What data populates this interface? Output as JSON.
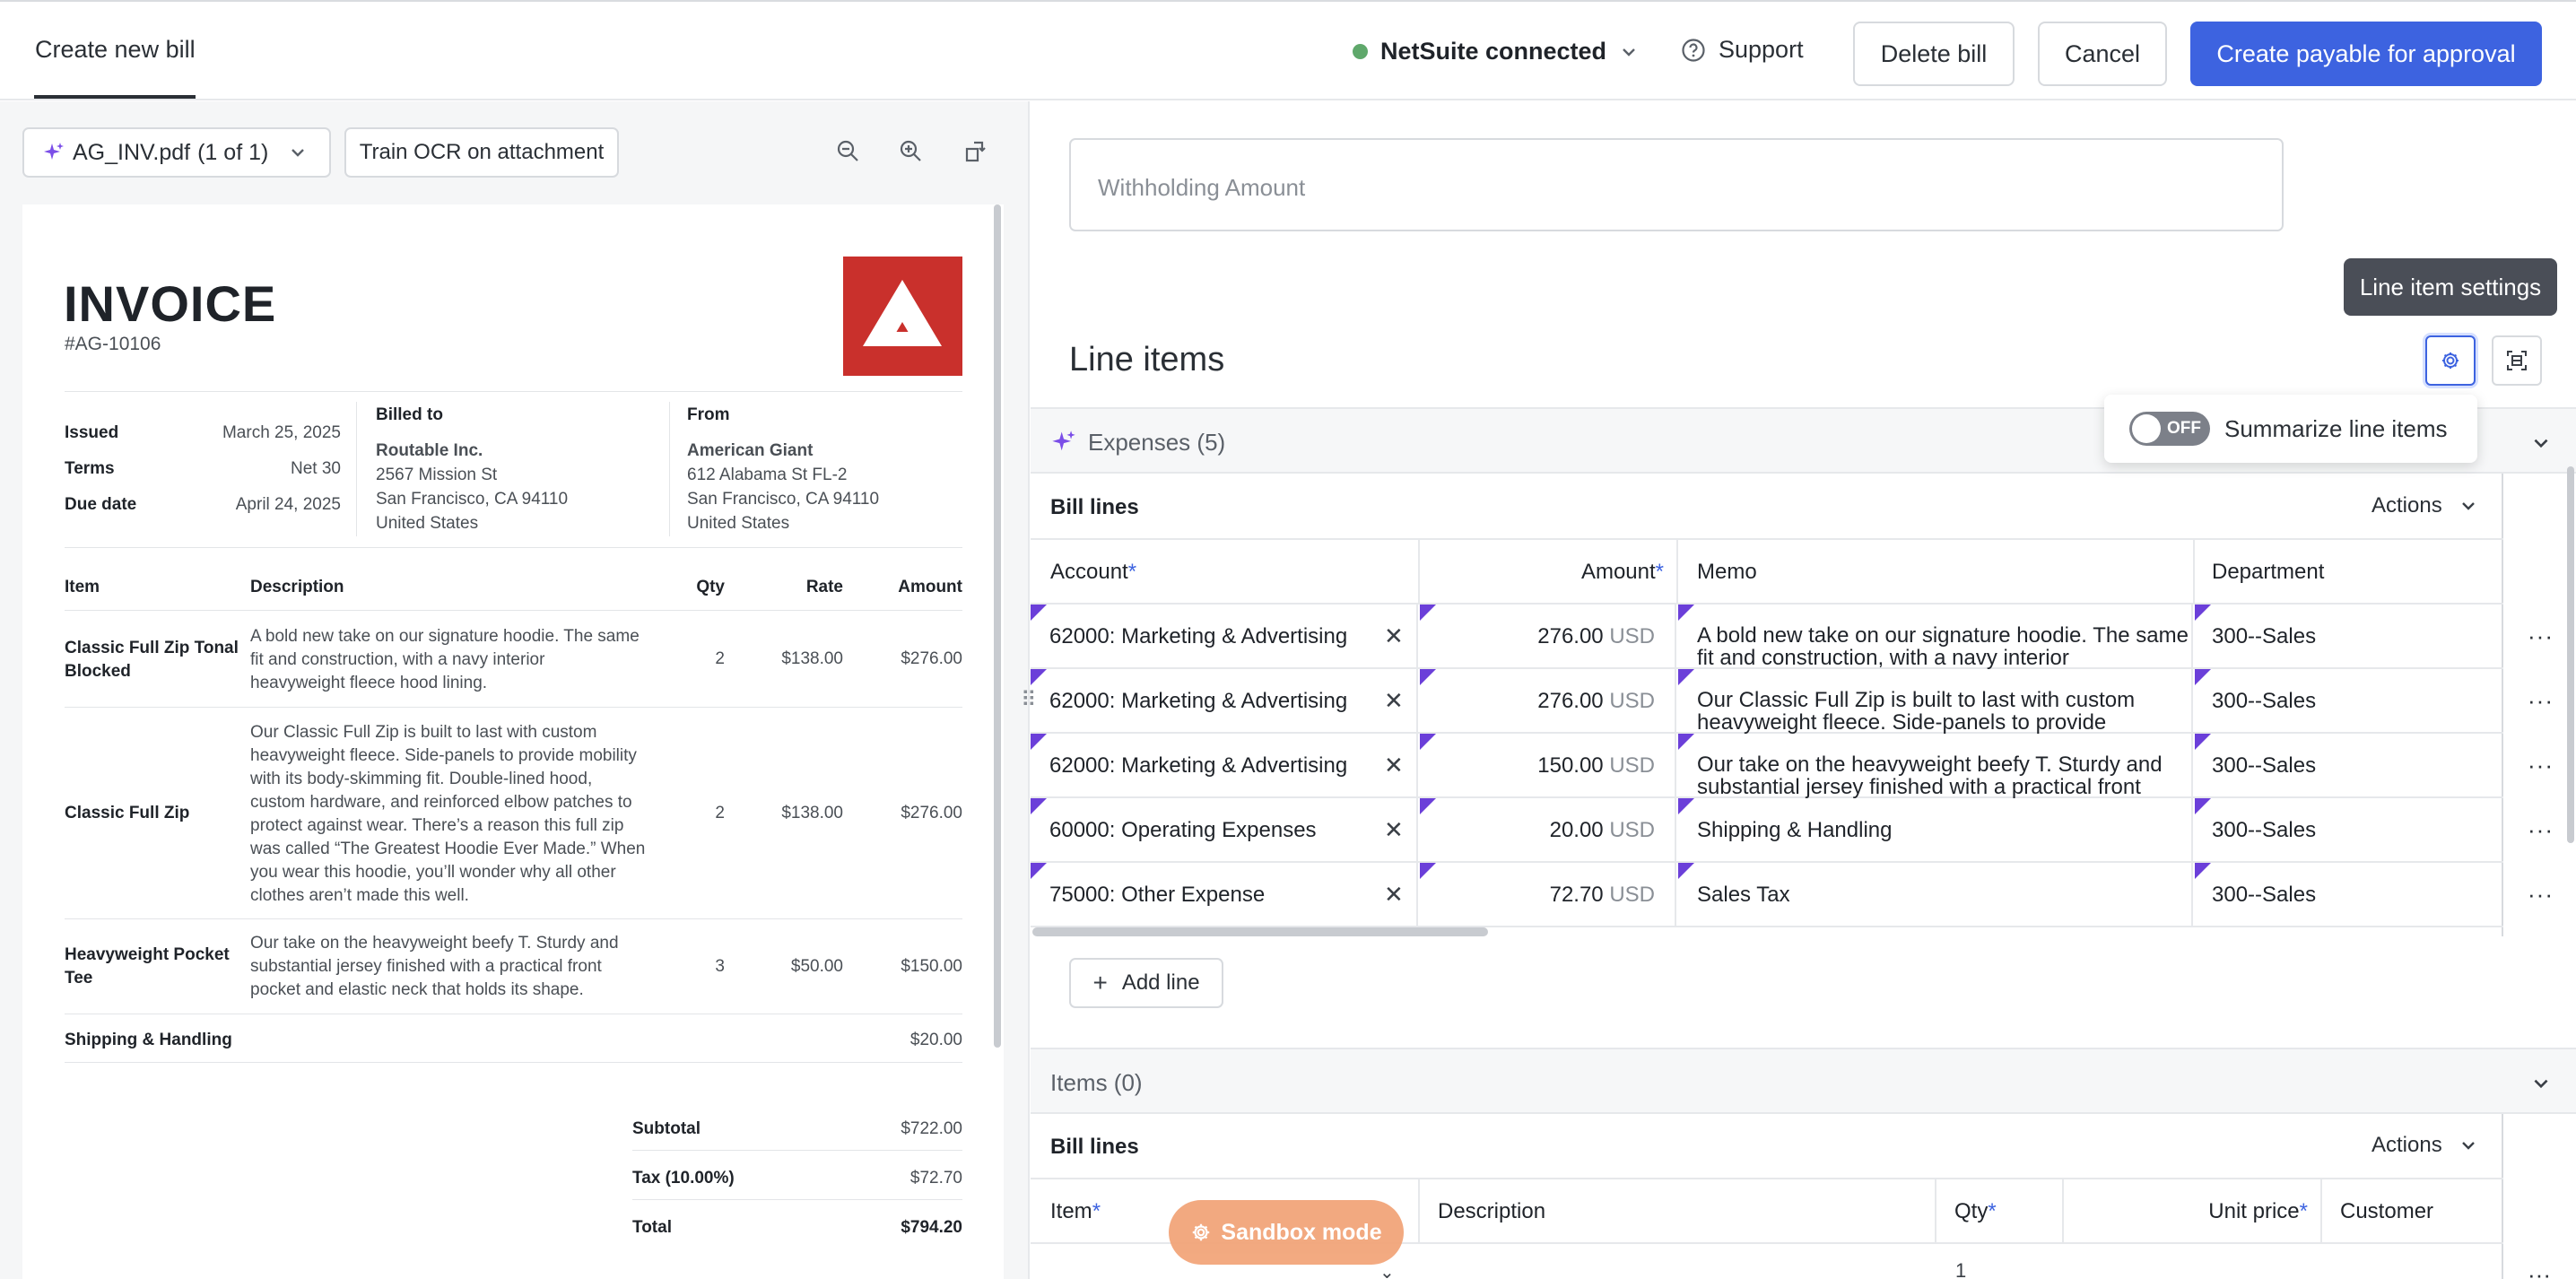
{
  "header": {
    "tab_label": "Create new bill",
    "netsuite_label": "NetSuite connected",
    "support_label": "Support",
    "delete_label": "Delete bill",
    "cancel_label": "Cancel",
    "create_label": "Create payable for approval"
  },
  "viewer": {
    "file_name": "AG_INV.pdf",
    "file_count": "(1 of 1)",
    "train_label": "Train OCR on attachment"
  },
  "invoice": {
    "title": "INVOICE",
    "number": "#AG-10106",
    "meta": [
      {
        "label": "Issued",
        "value": "March 25, 2025"
      },
      {
        "label": "Terms",
        "value": "Net 30"
      },
      {
        "label": "Due date",
        "value": "April 24, 2025"
      }
    ],
    "billed_to_label": "Billed to",
    "billed_to": [
      "Routable Inc.",
      "2567 Mission St",
      "San Francisco, CA 94110",
      "United States"
    ],
    "from_label": "From",
    "from": [
      "American Giant",
      "612 Alabama St FL-2",
      "San Francisco, CA 94110",
      "United States"
    ],
    "columns": {
      "item": "Item",
      "description": "Description",
      "qty": "Qty",
      "rate": "Rate",
      "amount": "Amount"
    },
    "rows": [
      {
        "item": [
          "Classic Full Zip Tonal",
          "Blocked"
        ],
        "desc": [
          "A bold new take on our signature hoodie. The same",
          "fit and construction, with a navy interior",
          "heavyweight fleece hood lining."
        ],
        "qty": "2",
        "rate": "$138.00",
        "amount": "$276.00"
      },
      {
        "item": [
          "Classic Full Zip"
        ],
        "desc": [
          "Our Classic Full Zip is built to last with custom",
          "heavyweight fleece. Side-panels to provide mobility",
          "with its body-skimming fit. Double-lined hood,",
          "custom hardware, and reinforced elbow patches to",
          "protect against wear. There’s a reason this full zip",
          "was called “The Greatest Hoodie Ever Made.” When",
          "you wear this hoodie, you’ll wonder why all other",
          "clothes aren’t made this well."
        ],
        "qty": "2",
        "rate": "$138.00",
        "amount": "$276.00"
      },
      {
        "item": [
          "Heavyweight Pocket",
          "Tee"
        ],
        "desc": [
          "Our take on the heavyweight beefy T. Sturdy and",
          "substantial jersey finished with a practical front",
          "pocket and elastic neck that holds its shape."
        ],
        "qty": "3",
        "rate": "$50.00",
        "amount": "$150.00"
      }
    ],
    "shipping_label": "Shipping & Handling",
    "shipping_amount": "$20.00",
    "totals": [
      {
        "label": "Subtotal",
        "value": "$722.00"
      },
      {
        "label": "Tax (10.00%)",
        "value": "$72.70"
      },
      {
        "label": "Total",
        "value": "$794.20"
      }
    ]
  },
  "form": {
    "withholding_placeholder": "Withholding Amount",
    "line_items_title": "Line items",
    "tooltip": "Line item settings",
    "toggle_state": "OFF",
    "summarize_label": "Summarize line items",
    "expenses_label": "Expenses (5)",
    "bill_lines_label": "Bill lines",
    "actions_label": "Actions",
    "expense_columns": {
      "account": "Account",
      "amount": "Amount",
      "memo": "Memo",
      "department": "Department"
    },
    "expense_rows": [
      {
        "account": "62000: Marketing & Advertising",
        "amount": "276.00",
        "currency": "USD",
        "memo": [
          "A bold new take on our signature hoodie. The same",
          "fit and construction, with a navy interior"
        ],
        "department": "300--Sales"
      },
      {
        "account": "62000: Marketing & Advertising",
        "amount": "276.00",
        "currency": "USD",
        "memo": [
          "Our Classic Full Zip is built to last with custom",
          "heavyweight fleece. Side-panels to provide"
        ],
        "department": "300--Sales"
      },
      {
        "account": "62000: Marketing & Advertising",
        "amount": "150.00",
        "currency": "USD",
        "memo": [
          "Our take on the heavyweight beefy T. Sturdy and",
          "substantial jersey finished with a practical front"
        ],
        "department": "300--Sales"
      },
      {
        "account": "60000: Operating Expenses",
        "amount": "20.00",
        "currency": "USD",
        "memo": [
          "Shipping & Handling"
        ],
        "department": "300--Sales"
      },
      {
        "account": "75000: Other Expense",
        "amount": "72.70",
        "currency": "USD",
        "memo": [
          "Sales Tax"
        ],
        "department": "300--Sales"
      }
    ],
    "add_line_label": "Add line",
    "items_label": "Items (0)",
    "items_columns": {
      "item": "Item",
      "description": "Description",
      "qty": "Qty",
      "unit_price": "Unit price",
      "customer": "Customer"
    },
    "items_first_qty": "1",
    "required_mark": "*",
    "sandbox_label": "Sandbox mode"
  },
  "colors": {
    "primary": "#3d63e0",
    "connected": "#5fa86b",
    "flag": "#6b3fd9",
    "sandbox": "#f2a57a",
    "logo": "#c9302c"
  }
}
